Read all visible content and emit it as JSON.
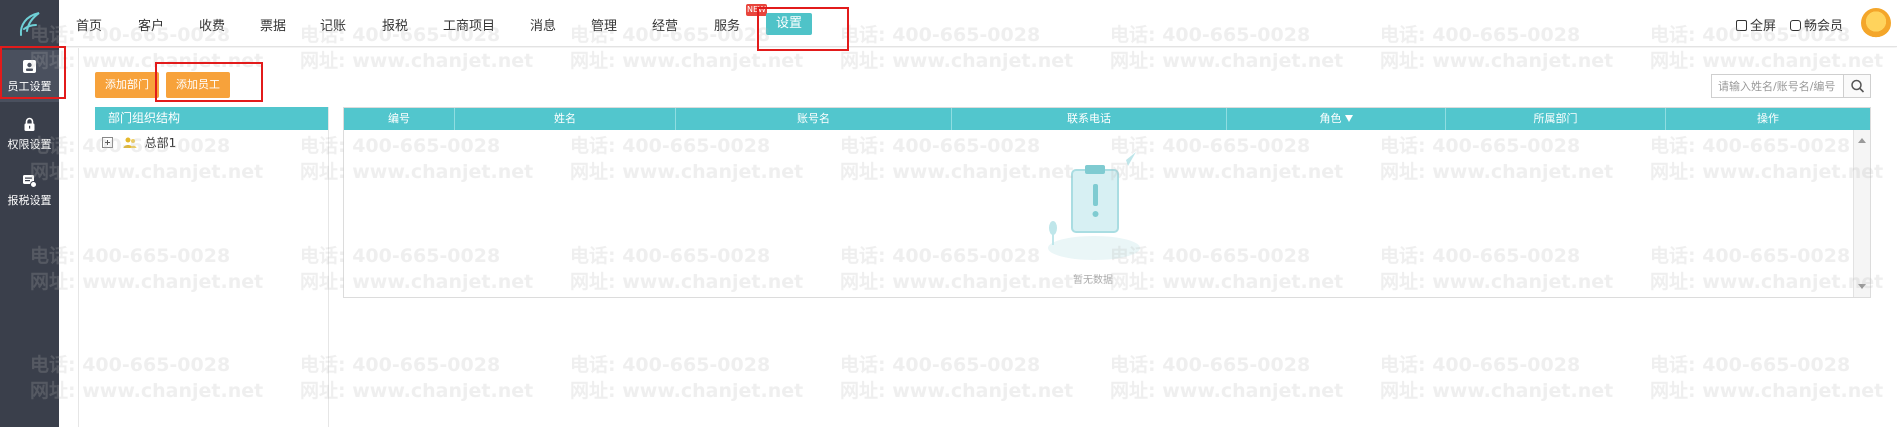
{
  "left_rail": {
    "items": [
      {
        "label": "员工设置",
        "icon": "employee-card-icon"
      },
      {
        "label": "权限设置",
        "icon": "lock-icon"
      },
      {
        "label": "报税设置",
        "icon": "tax-settings-icon"
      }
    ]
  },
  "top_nav": {
    "items": [
      "首页",
      "客户",
      "收费",
      "票据",
      "记账",
      "报税",
      "工商项目",
      "消息",
      "管理",
      "经营",
      "服务",
      "设置"
    ],
    "active": "设置",
    "badge": "NEW"
  },
  "top_tools": {
    "fullscreen_label": "全屏",
    "member_label": "畅会员"
  },
  "toolbar": {
    "add_department_label": "添加部门",
    "add_employee_label": "添加员工"
  },
  "search": {
    "placeholder": "请输入姓名/账号名/编号"
  },
  "tree": {
    "header": "部门组织结构",
    "nodes": [
      {
        "label": "总部1"
      }
    ]
  },
  "grid": {
    "columns": [
      "编号",
      "姓名",
      "账号名",
      "联系电话",
      "角色",
      "所属部门",
      "操作"
    ],
    "empty_text": "暂无数据"
  },
  "watermark": {
    "phone": "电话: 400-665-0028",
    "site": "网址: www.chanjet.net"
  },
  "colors": {
    "accent": "#52c6cd",
    "button": "#f7a23b",
    "rail": "#3a3f4b",
    "highlight": "#e21b1b"
  }
}
